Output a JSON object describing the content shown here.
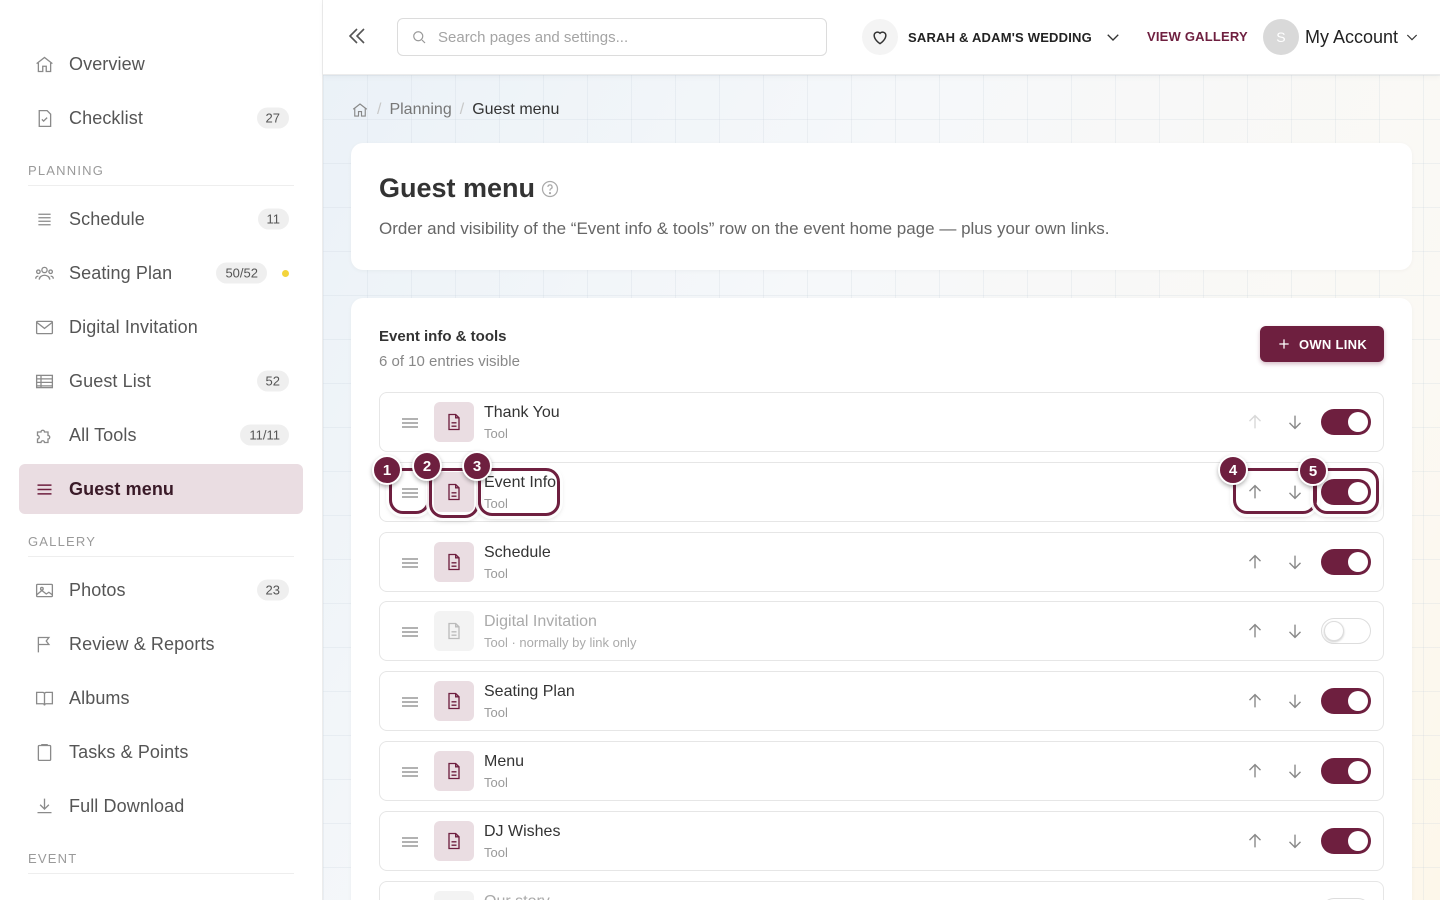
{
  "sidebar": {
    "items_top": [
      {
        "label": "Overview",
        "icon": "home-icon"
      },
      {
        "label": "Checklist",
        "icon": "checklist-icon",
        "badge": "27"
      }
    ],
    "section_planning": "PLANNING",
    "items_planning": [
      {
        "label": "Schedule",
        "icon": "schedule-icon",
        "badge": "11"
      },
      {
        "label": "Seating Plan",
        "icon": "seating-icon",
        "badge": "50/52"
      },
      {
        "label": "Digital Invitation",
        "icon": "mail-icon"
      },
      {
        "label": "Guest List",
        "icon": "list-icon",
        "badge": "52"
      },
      {
        "label": "All Tools",
        "icon": "puzzle-icon",
        "badge": "11/11"
      },
      {
        "label": "Guest menu",
        "icon": "menu-icon"
      }
    ],
    "section_gallery": "GALLERY",
    "items_gallery": [
      {
        "label": "Photos",
        "icon": "image-icon",
        "badge": "23"
      },
      {
        "label": "Review & Reports",
        "icon": "flag-icon"
      },
      {
        "label": "Albums",
        "icon": "book-icon"
      },
      {
        "label": "Tasks & Points",
        "icon": "clipboard-icon"
      },
      {
        "label": "Full Download",
        "icon": "download-icon"
      }
    ],
    "section_event": "EVENT"
  },
  "topbar": {
    "search_placeholder": "Search pages and settings...",
    "event_name": "SARAH & ADAM'S WEDDING",
    "view_gallery": "VIEW GALLERY",
    "avatar_initial": "S",
    "account_label": "My Account"
  },
  "breadcrumb": {
    "planning": "Planning",
    "current": "Guest menu"
  },
  "header": {
    "title": "Guest menu",
    "description": "Order and visibility of the “Event info & tools” row on the event home page — plus your own links."
  },
  "list": {
    "title": "Event info & tools",
    "subtitle": "6 of 10 entries visible",
    "own_link_label": "OWN LINK",
    "rows": [
      {
        "name": "Thank You",
        "type": "Tool",
        "visible": true
      },
      {
        "name": "Event Info",
        "type": "Tool",
        "visible": true
      },
      {
        "name": "Schedule",
        "type": "Tool",
        "visible": true
      },
      {
        "name": "Digital Invitation",
        "type": "Tool · normally by link only",
        "visible": false
      },
      {
        "name": "Seating Plan",
        "type": "Tool",
        "visible": true
      },
      {
        "name": "Menu",
        "type": "Tool",
        "visible": true
      },
      {
        "name": "DJ Wishes",
        "type": "Tool",
        "visible": true
      },
      {
        "name": "Our story",
        "type": "",
        "visible": false
      }
    ]
  },
  "annotations": [
    "1",
    "2",
    "3",
    "4",
    "5"
  ],
  "colors": {
    "accent": "#6e1f3f",
    "accent_light": "#eadde2",
    "badge_dot": "#f3d43c"
  }
}
